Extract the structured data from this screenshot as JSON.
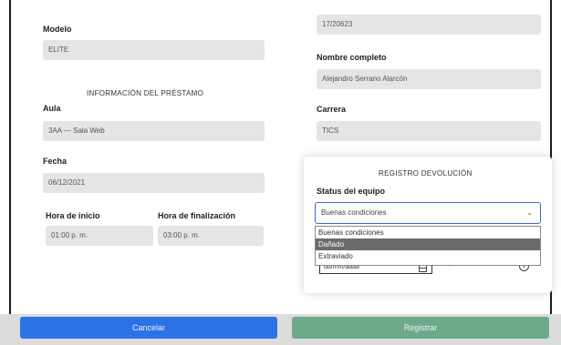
{
  "left": {
    "modelo_label": "Modelo",
    "modelo_value": "ELITE",
    "section_title": "INFORMACIÓN DEL PRÉSTAMO",
    "aula_label": "Aula",
    "aula_value": "3AA — Sala Web",
    "fecha_label": "Fecha",
    "fecha_value": "06/12/2021",
    "hora_inicio_label": "Hora de inicio",
    "hora_inicio_value": "01:00 p. m.",
    "hora_fin_label": "Hora de finalización",
    "hora_fin_value": "03:00 p. m."
  },
  "right": {
    "matricula_value": "17/20623",
    "nombre_label": "Nombre completo",
    "nombre_value": "Alejandro Serrano Alarcón",
    "carrera_label": "Carrera",
    "carrera_value": "TICS"
  },
  "devolucion": {
    "title": "REGISTRO DEVOLUCIÓN",
    "status_label": "Status del equipo",
    "selected": "Buenas condiciones",
    "options": [
      "Buenas condiciones",
      "Dañado",
      "Extraviado"
    ],
    "highlighted_index": 1,
    "date_placeholder": "dd/mm/aaaa",
    "time_placeholder": "--:-- ----"
  },
  "buttons": {
    "cancel": "Cancelar",
    "register": "Registrar"
  },
  "colors": {
    "cancel": "#2b72e6",
    "register": "#6ea98a",
    "field_bg": "#e5e5e5",
    "highlight": "#6b6b6b"
  }
}
